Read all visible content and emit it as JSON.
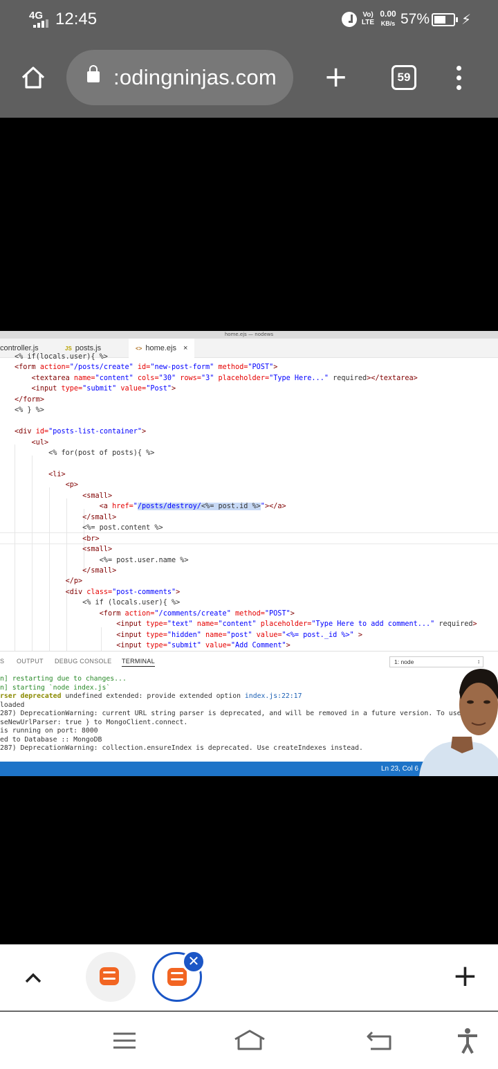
{
  "status_bar": {
    "network": "4G",
    "time": "12:45",
    "volte_top": "Vo)",
    "volte_bottom": "LTE",
    "speed_value": "0.00",
    "speed_unit": "KB/s",
    "battery": "57%",
    "battery_level": 0.57
  },
  "browser": {
    "url": ":odingninjas.com",
    "tab_count": "59"
  },
  "editor": {
    "window_title": "home.ejs — nodews",
    "tabs": [
      {
        "icon": "",
        "label": "controller.js"
      },
      {
        "icon": "JS",
        "label": "posts.js"
      },
      {
        "icon": "<>",
        "label": "home.ejs",
        "close": "×"
      }
    ],
    "code_lines": [
      "<% if(locals.user){ %>",
      "<form action=\"/posts/create\" id=\"new-post-form\" method=\"POST\">",
      "    <textarea name=\"content\" cols=\"30\" rows=\"3\" placeholder=\"Type Here...\" required></textarea>",
      "    <input type=\"submit\" value=\"Post\">",
      "</form>",
      "<% } %>",
      "",
      "<div id=\"posts-list-container\">",
      "    <ul>",
      "        <% for(post of posts){ %>",
      "",
      "        <li>",
      "            <p>",
      "                <small>",
      "                    <a href=\"/posts/destroy/<%= post.id %>\"></a>",
      "                </small>",
      "                <%= post.content %>",
      "                <br>",
      "                <small>",
      "                    <%= post.user.name %>",
      "                </small>",
      "            </p>",
      "            <div class=\"post-comments\">",
      "                <% if (locals.user){ %>",
      "                    <form action=\"/comments/create\" method=\"POST\">",
      "                        <input type=\"text\" name=\"content\" placeholder=\"Type Here to add comment...\" required>",
      "                        <input type=\"hidden\" name=\"post\" value=\"<%= post._id %>\" >",
      "                        <input type=\"submit\" value=\"Add Comment\">"
    ],
    "panel": {
      "tabs": [
        "S",
        "OUTPUT",
        "DEBUG CONSOLE",
        "TERMINAL"
      ],
      "active_tab": "TERMINAL",
      "terminal_selector": "1: node"
    },
    "terminal_lines": [
      "n] restarting due to changes...",
      "n] starting `node index.js`",
      "rser deprecated undefined extended: provide extended option index.js:22:17",
      "loaded",
      "287) DeprecationWarning: current URL string parser is deprecated, and will be removed in a future version. To use",
      "seNewUrlParser: true } to MongoClient.connect.",
      "is running on port: 8000",
      "ed to Database :: MongoDB",
      "287) DeprecationWarning: collection.ensureIndex is deprecated. Use createIndexes instead."
    ],
    "status_position": "Ln 23, Col 6"
  },
  "icons": {
    "home": "home-icon",
    "lock": "lock-icon",
    "new_tab": "plus-icon",
    "tabs": "tab-switcher-icon",
    "menu": "more-vert-icon",
    "collapse": "chevron-up-icon",
    "close_tab": "close-icon",
    "nav_menu": "menu-icon",
    "nav_home": "home-outline-icon",
    "nav_back": "back-icon",
    "accessibility": "accessibility-icon"
  },
  "colors": {
    "browser_bar": "#5f5f5f",
    "url_box": "#787878",
    "vscode_status": "#1e74c8",
    "tab_accent": "#1b56c6",
    "favicon": "#f26522"
  }
}
